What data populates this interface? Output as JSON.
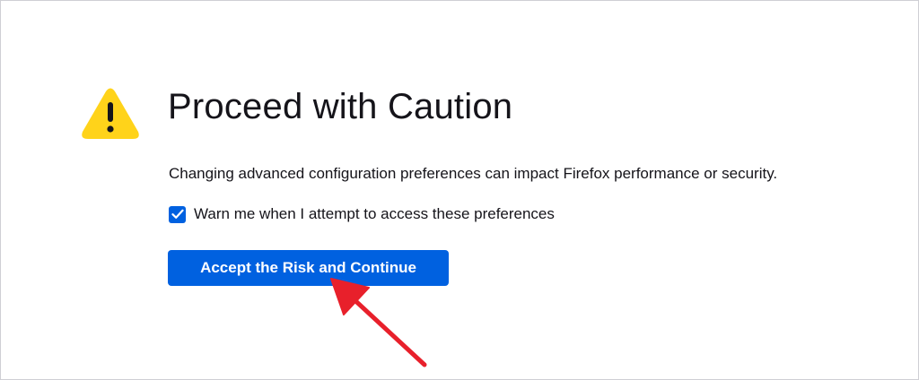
{
  "page": {
    "title": "Proceed with Caution",
    "description": "Changing advanced configuration preferences can impact Firefox performance or security.",
    "warn_checkbox": {
      "label": "Warn me when I attempt to access these preferences",
      "checked": true
    },
    "accept_button_label": "Accept the Risk and Continue",
    "icons": {
      "warning": "warning-triangle-icon",
      "checkmark": "checkmark-icon",
      "annotation": "red-arrow-annotation"
    }
  },
  "colors": {
    "accent": "#0061e0",
    "warning": "#ffd31a",
    "text": "#15141a",
    "arrow": "#e8202b"
  }
}
